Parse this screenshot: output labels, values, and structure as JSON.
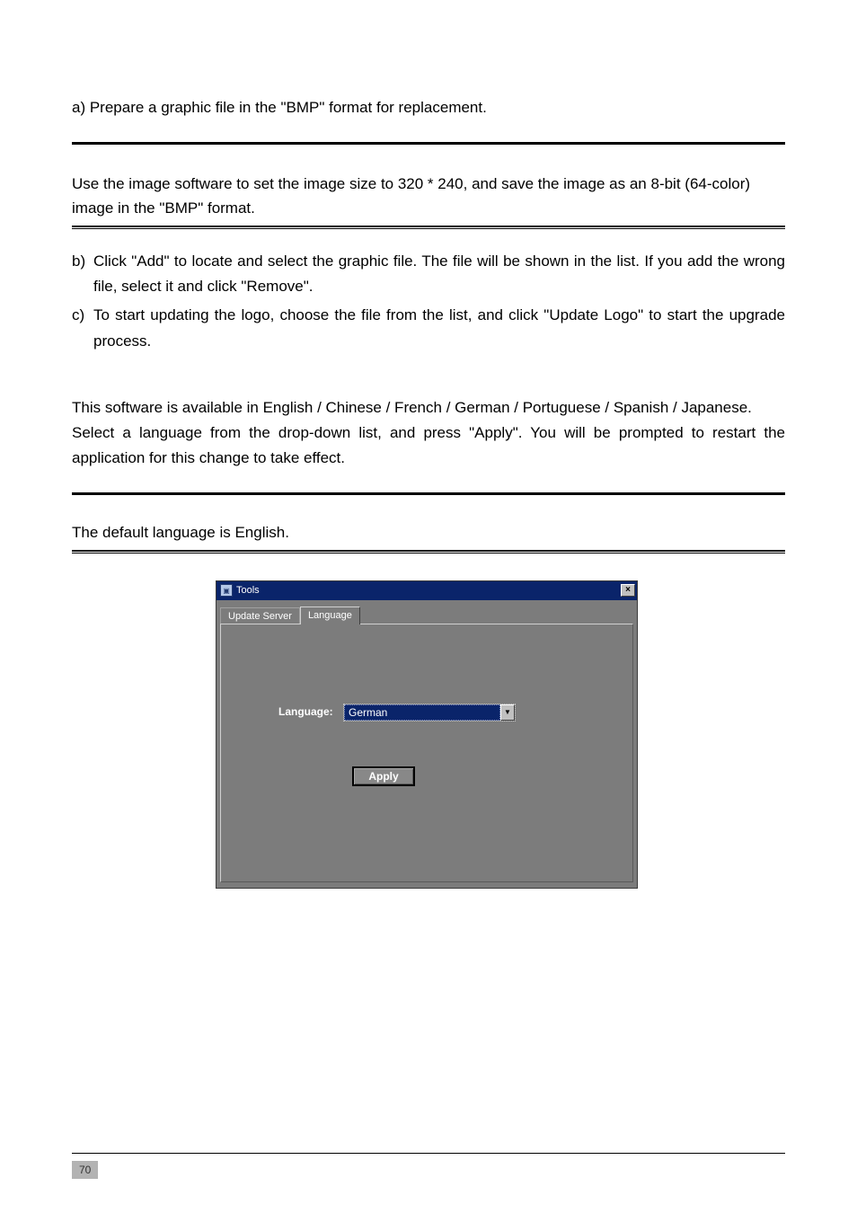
{
  "step_a": "a) Prepare a graphic file in the \"BMP\" format for replacement.",
  "note1": "Use the image software to set the image size to 320 * 240, and save the image as an 8-bit (64-color) image in the \"BMP\" format.",
  "step_b": {
    "marker": "b)",
    "text": "Click \"Add\" to locate and select the graphic file. The file will be shown in the list. If you add the wrong file, select it and click \"Remove\"."
  },
  "step_c": {
    "marker": "c)",
    "text": "To start updating the logo, choose the file from the list, and click \"Update Logo\" to start the upgrade process."
  },
  "lang_para1": "This software is available in English / Chinese / French / German / Portuguese / Spanish / Japanese.",
  "lang_para2": "Select a language from the drop-down list, and press \"Apply\". You will be prompted to restart the application for this change to take effect.",
  "note2": "The default language is English.",
  "dialog": {
    "title": "Tools",
    "close": "×",
    "tabs": {
      "t0": "Update Server",
      "t1": "Language"
    },
    "lang_label": "Language:",
    "lang_value": "German",
    "apply": "Apply"
  },
  "page_number": "70"
}
